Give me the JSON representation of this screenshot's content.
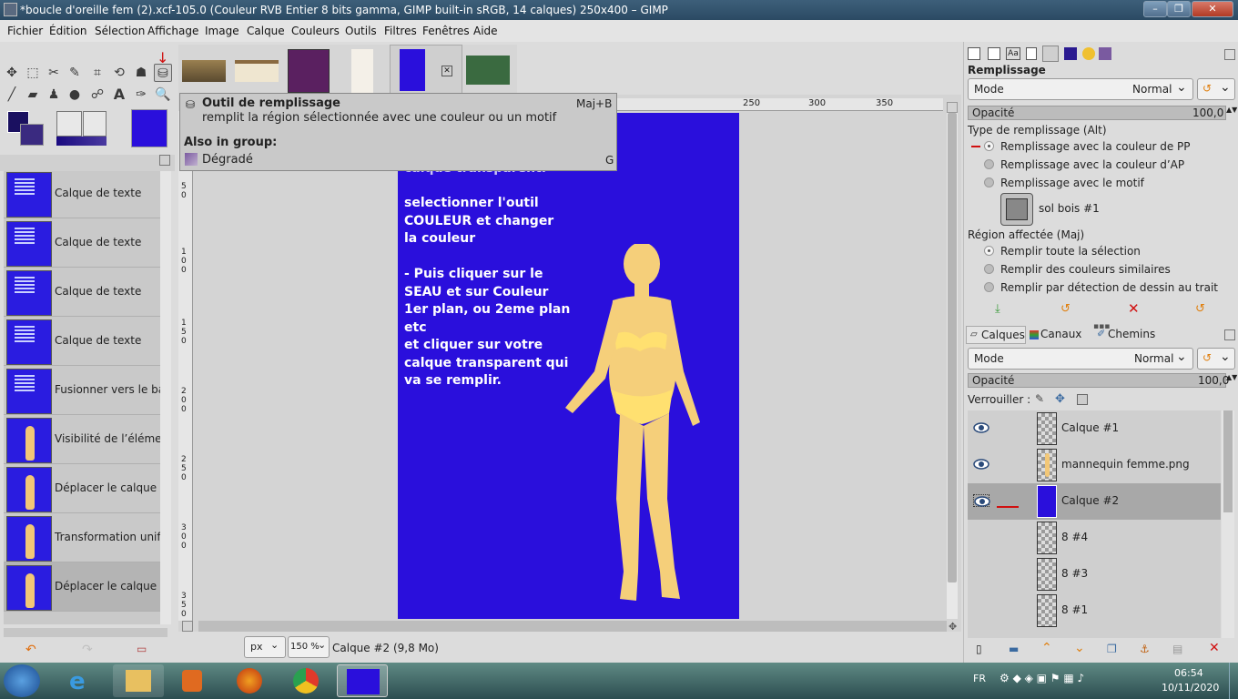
{
  "window": {
    "title": "*boucle d'oreille fem (2).xcf-105.0 (Couleur RVB Entier 8 bits gamma, GIMP built-in sRGB, 14 calques) 250x400 – GIMP",
    "minimize": "–",
    "maximize": "❐",
    "close": "✕"
  },
  "menu": [
    "Fichier",
    "Édition",
    "Sélection",
    "Affichage",
    "Image",
    "Calque",
    "Couleurs",
    "Outils",
    "Filtres",
    "Fenêtres",
    "Aide"
  ],
  "tooltip": {
    "title": "Outil de remplissage",
    "shortcut": "Maj+B",
    "description": "remplit la région sélectionnée avec une couleur ou un motif",
    "group_header": "Also in group:",
    "group_item": "Dégradé",
    "group_item_shortcut": "G"
  },
  "ruler": {
    "top": [
      "250",
      "300",
      "350"
    ],
    "left": [
      "5\n0",
      "1\n0\n0",
      "1\n5\n0",
      "2\n0\n0",
      "2\n5\n0",
      "3\n0\n0",
      "3\n5\n0"
    ]
  },
  "image_text": {
    "line0": "calque transparent.",
    "lines": [
      " selectionner l'outil",
      "COULEUR et changer",
      "la couleur",
      "",
      "- Puis cliquer sur le",
      "SEAU et sur Couleur",
      "1er plan, ou 2eme plan",
      "etc",
      "et cliquer sur votre",
      "calque transparent qui",
      "va se remplir."
    ]
  },
  "history": [
    {
      "label": "Calque de texte",
      "thumb": "text"
    },
    {
      "label": "Calque de texte",
      "thumb": "text"
    },
    {
      "label": "Calque de texte",
      "thumb": "text"
    },
    {
      "label": "Calque de texte",
      "thumb": "text"
    },
    {
      "label": "Fusionner vers le ba",
      "thumb": "text"
    },
    {
      "label": "Visibilité de l’élémen",
      "thumb": "figure"
    },
    {
      "label": "Déplacer le calque",
      "thumb": "figure"
    },
    {
      "label": "Transformation unif",
      "thumb": "figure"
    },
    {
      "label": "Déplacer le calque",
      "thumb": "figure"
    }
  ],
  "status": {
    "unit": "px",
    "zoom": "150 %",
    "info": "Calque #2 (9,8 Mo)"
  },
  "tool_options": {
    "heading": "Remplissage",
    "mode_label": "Mode",
    "mode_value": "Normal",
    "opacity_label": "Opacité",
    "opacity_value": "100,0",
    "fill_type_label": "Type de remplissage  (Alt)",
    "fill_types": [
      "Remplissage avec la couleur de PP",
      "Remplissage avec la couleur d’AP",
      "Remplissage avec le motif"
    ],
    "pattern_name": "sol bois #1",
    "region_label": "Région affectée  (Maj)",
    "regions": [
      "Remplir toute la sélection",
      "Remplir des couleurs similaires",
      "Remplir par détection de dessin au trait"
    ]
  },
  "layers_panel": {
    "tabs": [
      "Calques",
      "Canaux",
      "Chemins"
    ],
    "mode_label": "Mode",
    "mode_value": "Normal",
    "opacity_label": "Opacité",
    "opacity_value": "100,0",
    "lock_label": "Verrouiller :",
    "layers": [
      {
        "name": "Calque #1",
        "visible": true,
        "selected": false,
        "thumb": "checker"
      },
      {
        "name": "mannequin femme.png",
        "visible": true,
        "selected": false,
        "thumb": "figure"
      },
      {
        "name": "Calque #2",
        "visible": true,
        "selected": true,
        "thumb": "blue"
      },
      {
        "name": "8 #4",
        "visible": false,
        "selected": false,
        "thumb": "checker"
      },
      {
        "name": "8 #3",
        "visible": false,
        "selected": false,
        "thumb": "checker"
      },
      {
        "name": "8 #1",
        "visible": false,
        "selected": false,
        "thumb": "checker"
      }
    ]
  },
  "taskbar": {
    "lang": "FR",
    "time": "06:54",
    "date": "10/11/2020"
  },
  "colors": {
    "canvas_blue": "#2a0fdc",
    "fg_color": "#1a1060",
    "bg_color": "#3a2a80"
  }
}
